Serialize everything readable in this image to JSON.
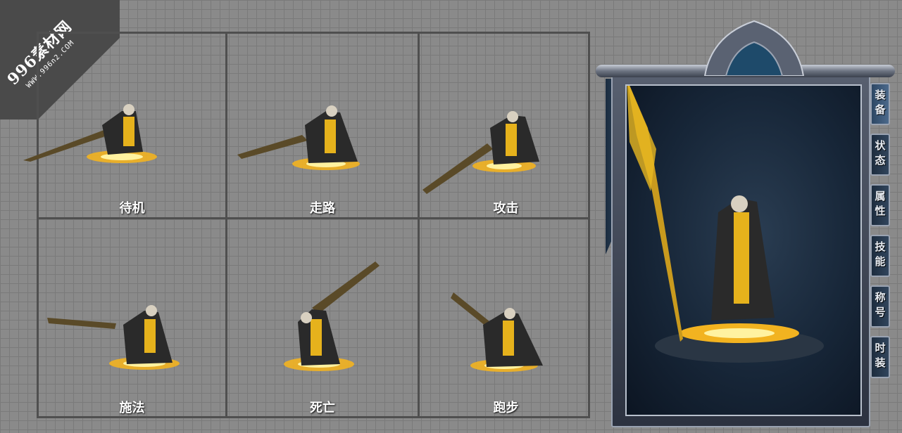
{
  "watermark": {
    "brand": "996素材网",
    "url": "WWW.996n2.COM"
  },
  "motions": [
    {
      "label": "待机"
    },
    {
      "label": "走路"
    },
    {
      "label": "攻击"
    },
    {
      "label": "施法"
    },
    {
      "label": "死亡"
    },
    {
      "label": "跑步"
    }
  ],
  "panel": {
    "tabs": [
      {
        "label": "装备",
        "active": true
      },
      {
        "label": "状态",
        "active": false
      },
      {
        "label": "属性",
        "active": false
      },
      {
        "label": "技能",
        "active": false
      },
      {
        "label": "称号",
        "active": false
      },
      {
        "label": "时装",
        "active": false
      }
    ]
  },
  "colors": {
    "grid_bg": "#8a8a8a",
    "grid_line": "#4f4f4f",
    "gold": "#e8b820",
    "panel_dark": "#172638"
  }
}
